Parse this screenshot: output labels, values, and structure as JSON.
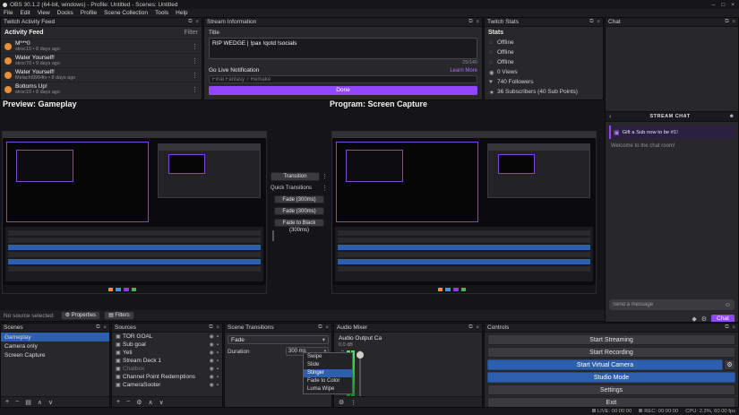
{
  "window": {
    "title": "OBS 30.1.2 (64-bit, windows) - Profile: Untitled - Scenes: Untitled"
  },
  "menu": {
    "items": [
      "File",
      "Edit",
      "View",
      "Docks",
      "Profile",
      "Scene Collection",
      "Tools",
      "Help"
    ]
  },
  "icons": {
    "popout": "⧉",
    "close": "×",
    "kebab": "⋮",
    "chevron_down": "▾",
    "chevron_up": "▴",
    "eye": "◉",
    "lock": "▪",
    "gear": "⚙",
    "plus": "+",
    "minus": "−",
    "filter": "▤",
    "up": "∧",
    "down": "∨",
    "smiley": "☺",
    "back": "‹",
    "viewers": "☻",
    "gift": "▣",
    "bits": "◆",
    "speaker": "◀",
    "min": "–",
    "max": "□",
    "source": "▣"
  },
  "activity_feed": {
    "dock_title": "Twitch Activity Feed",
    "header": "Activity Feed",
    "filter_label": "Filter",
    "items": [
      {
        "title": "M***0",
        "subtitle": "stroc10 • 8 days ago"
      },
      {
        "title": "Water Yourself!",
        "subtitle": "stroc70 • 9 days ago"
      },
      {
        "title": "Water Yourself!",
        "subtitle": "Melachi0954tv • 8 days ago"
      },
      {
        "title": "Bottoms Up!",
        "subtitle": "stroc10 • 8 days ago"
      }
    ]
  },
  "stream_info": {
    "dock_title": "Stream Information",
    "title_label": "Title",
    "title_value": "RIP WEDGE | !pax !qotd !socials",
    "char_count": "25/140",
    "notification_label": "Go Live Notification",
    "learn_more": "Learn More",
    "notification_placeholder": "Final Fantasy 7 Remake",
    "done_label": "Done"
  },
  "twitch_stats": {
    "dock_title": "Twitch Stats",
    "header": "Stats",
    "rows": [
      {
        "icon": "◌",
        "label": "Offline"
      },
      {
        "icon": "◌",
        "label": "Offline"
      },
      {
        "icon": "◌",
        "label": "Offline"
      },
      {
        "icon": "◉",
        "label": "0 Views"
      },
      {
        "icon": "♥",
        "label": "740 Followers"
      },
      {
        "icon": "★",
        "label": "36 Subscribers (40 Sub Points)"
      }
    ]
  },
  "chat": {
    "dock_title": "Chat",
    "header": "STREAM CHAT",
    "gift_banner": "Gift a Sub now to be #1!",
    "welcome": "Welcome to the chat room!",
    "input_placeholder": "Send a message",
    "chat_button": "Chat"
  },
  "preview": {
    "label": "Preview: Gameplay"
  },
  "program": {
    "label": "Program: Screen Capture"
  },
  "transition_panel": {
    "transition_button": "Transition",
    "quick_transitions_label": "Quick Transitions",
    "buttons": [
      "Fade (300ms)",
      "Fade (300ms)",
      "Fade to Black (300ms)"
    ]
  },
  "source_toolbar": {
    "status": "No source selected",
    "properties": "Properties",
    "filters": "Filters"
  },
  "scenes": {
    "dock_title": "Scenes",
    "items": [
      {
        "name": "Gameplay"
      },
      {
        "name": "Camera only"
      },
      {
        "name": "Screen Capture"
      }
    ]
  },
  "sources": {
    "dock_title": "Sources",
    "items": [
      {
        "name": "TOR GOAL"
      },
      {
        "name": "Sub goal"
      },
      {
        "name": "Yeti"
      },
      {
        "name": "Stream Deck 1"
      },
      {
        "name": "Chatbox"
      },
      {
        "name": "Channel Point Redemptions"
      },
      {
        "name": "CameraSooter"
      }
    ]
  },
  "scene_transitions": {
    "dock_title": "Scene Transitions",
    "selected_transition": "Fade",
    "duration_label": "Duration",
    "duration_value": "300 ms",
    "dropdown_options": [
      "Swipe",
      "Slide",
      "Stinger",
      "Fade to Color",
      "Luma Wipe"
    ],
    "dropdown_selected": "Stinger"
  },
  "audio_mixer": {
    "dock_title": "Audio Mixer",
    "source_name": "Audio Output Ca",
    "db_value": "0.0 dB"
  },
  "controls": {
    "dock_title": "Controls",
    "buttons": [
      {
        "label": "Start Streaming"
      },
      {
        "label": "Start Recording"
      },
      {
        "label": "Start Virtual Camera"
      },
      {
        "label": "Studio Mode"
      },
      {
        "label": "Settings"
      },
      {
        "label": "Exit"
      }
    ]
  },
  "status_bar": {
    "live": "LIVE: 00:00:00",
    "rec": "REC: 00:00:00",
    "stats": "CPU: 2.3%, 60.00 fps"
  },
  "colors": {
    "accent_blue": "#2e5fae",
    "twitch_purple": "#9147ff",
    "meter_green": "#35c43c"
  }
}
